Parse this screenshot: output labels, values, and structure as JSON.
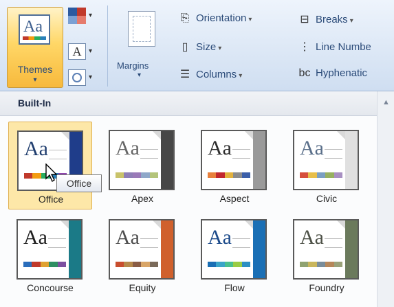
{
  "ribbon": {
    "themes_label": "Themes",
    "margins_label": "Margins",
    "orientation_label": "Orientation",
    "size_label": "Size",
    "columns_label": "Columns",
    "breaks_label": "Breaks",
    "line_numbers_label": "Line Numbe",
    "hyphenation_label": "Hyphenatic"
  },
  "gallery": {
    "section_header": "Built-In",
    "tooltip": "Office",
    "themes": [
      {
        "name": "Office",
        "text_color": "#1f3d6e",
        "accent": "#1f3d8a",
        "bar": [
          "#c0392b",
          "#f39c12",
          "#27ae60",
          "#2980b9",
          "#8e44ad"
        ]
      },
      {
        "name": "Apex",
        "text_color": "#666666",
        "accent": "#474747",
        "bar": [
          "#c9c36a",
          "#8e7fb6",
          "#9a7ab8",
          "#8fa8c9",
          "#b4c47a"
        ]
      },
      {
        "name": "Aspect",
        "text_color": "#2c2c2c",
        "accent": "#9a9a9a",
        "bar": [
          "#e8803c",
          "#c1272d",
          "#e2b13c",
          "#8b8b8b",
          "#3b5ea8"
        ]
      },
      {
        "name": "Civic",
        "text_color": "#5a6f8a",
        "accent": "#e0e0e0",
        "bar": [
          "#d64f3b",
          "#e8bf4a",
          "#7b9fc2",
          "#97b060",
          "#a890c2"
        ]
      },
      {
        "name": "Concourse",
        "text_color": "#1e1e1e",
        "accent": "#1b7a87",
        "bar": [
          "#2a6dbb",
          "#c0392b",
          "#e0a130",
          "#2e8f63",
          "#7b4fa0"
        ]
      },
      {
        "name": "Equity",
        "text_color": "#4e4e4e",
        "accent": "#d0602c",
        "bar": [
          "#c84e2e",
          "#b6894a",
          "#8a5c44",
          "#d9a566",
          "#7a6a5a"
        ]
      },
      {
        "name": "Flow",
        "text_color": "#1b4a8a",
        "accent": "#1a6fb5",
        "bar": [
          "#1a6fb5",
          "#3aa5c8",
          "#49c08e",
          "#99cc44",
          "#2c8fc2"
        ]
      },
      {
        "name": "Foundry",
        "text_color": "#4d5147",
        "accent": "#6b7a5c",
        "bar": [
          "#8fa270",
          "#c9b65c",
          "#7a8d9a",
          "#b6875a",
          "#9aa27a"
        ]
      }
    ]
  }
}
